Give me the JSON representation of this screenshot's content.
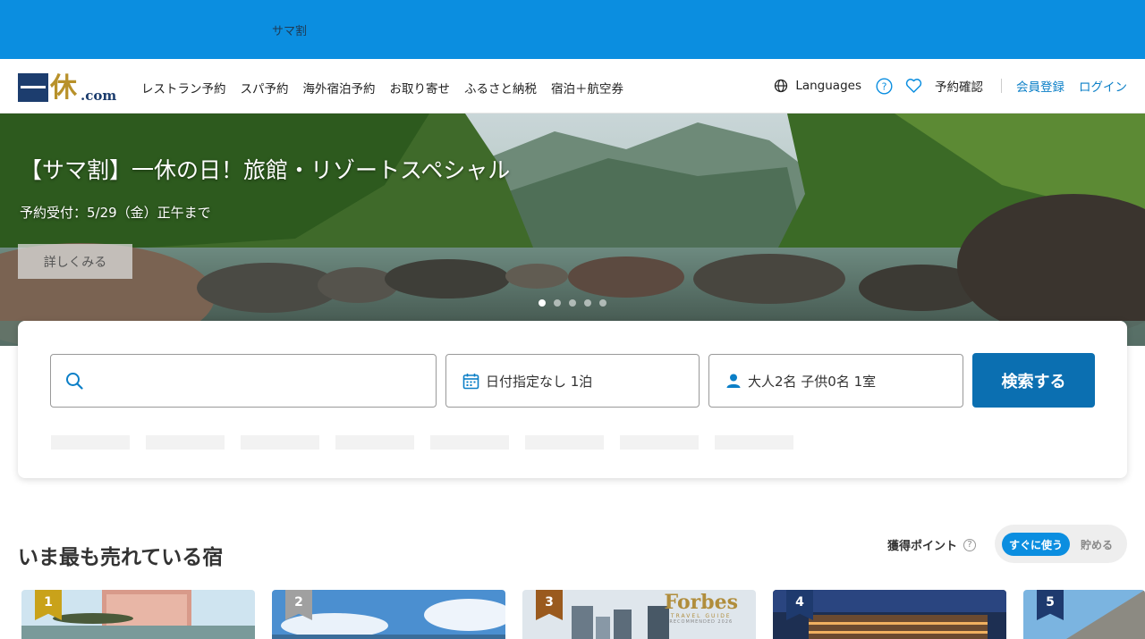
{
  "top_banner": {
    "promo_text": "サマ割",
    "color": "#0b8ee0"
  },
  "header": {
    "logo_text": "一休.com",
    "nav": [
      "レストラン予約",
      "スパ予約",
      "海外宿泊予約",
      "お取り寄せ",
      "ふるさと納税",
      "宿泊＋航空券"
    ],
    "languages": "Languages",
    "help_icon": "question-circle-icon",
    "favorite_icon": "heart-icon",
    "reservation_confirm": "予約確認",
    "register": "会員登録",
    "login": "ログイン"
  },
  "hero": {
    "title": "【サマ割】一休の日！旅館・リゾートスペシャル",
    "subtitle": "予約受付：5/29（金）正午まで",
    "button": "詳しくみる",
    "slide_count": 5,
    "active_slide": 1
  },
  "search": {
    "keyword_placeholder": "",
    "date_value": "日付指定なし 1泊",
    "guests_value": "大人2名  子供0名  1室",
    "search_button": "検索する",
    "accent": "#0b6fb1"
  },
  "ranking": {
    "title": "いま最も売れている宿",
    "points_label": "獲得ポイント",
    "toggle_on": "すぐに使う",
    "toggle_off": "貯める",
    "cards": [
      {
        "rank": "1",
        "rank_color": "#c9a21a"
      },
      {
        "rank": "2",
        "rank_color": "#a0a0a0"
      },
      {
        "rank": "3",
        "rank_color": "#9a5a1e",
        "badge_title": "Forbes",
        "badge_line1": "TRAVEL GUIDE",
        "badge_line2": "RECOMMENDED 2026"
      },
      {
        "rank": "4",
        "rank_color": "#1e3a6e"
      },
      {
        "rank": "5",
        "rank_color": "#1e3a6e"
      }
    ]
  }
}
